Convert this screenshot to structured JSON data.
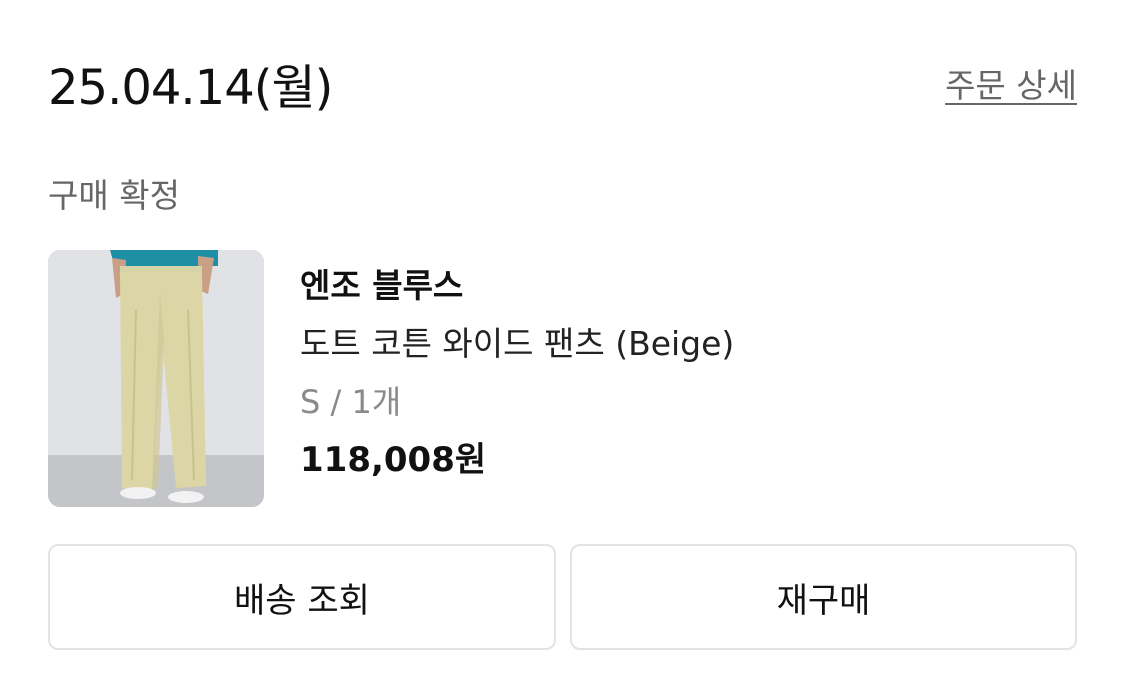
{
  "order": {
    "date": "25.04.14(월)",
    "detail_link": "주문 상세",
    "status": "구매 확정"
  },
  "product": {
    "image_icon": "beige-wide-pants-photo",
    "brand": "엔조 블루스",
    "name": "도트 코튼 와이드 팬츠 (Beige)",
    "option": "S / 1개",
    "price": "118,008원"
  },
  "actions": {
    "tracking_label": "배송 조회",
    "reorder_label": "재구매"
  },
  "colors": {
    "text_primary": "#111111",
    "text_secondary": "#666666",
    "text_muted": "#8a8a8a",
    "button_border": "#e3e3e3"
  }
}
